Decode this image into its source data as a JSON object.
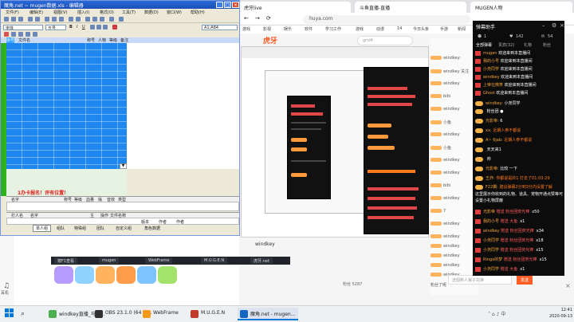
{
  "browser": {
    "tabs": [
      "虎牙live",
      "斗鱼直播-直播",
      "MUGEN人物"
    ],
    "url": "huya.com",
    "bookmarks": [
      "游戏",
      "影视",
      "娱乐",
      "软件",
      "学习工作",
      "游戏",
      "动漫",
      "14",
      "今日头条",
      "手游",
      "新闻"
    ]
  },
  "site": {
    "logo": "虎牙",
    "search_placeholder": "grid4",
    "host_name": "windkey",
    "fans_label": "粉丝 5287",
    "input_placeholder": "送個新人電子兑换",
    "send_label": "发送",
    "mini_taskbar": [
      "按F1查看",
      "mugen",
      "WebFrame",
      "M.U.G.E.N",
      "虎牙.net"
    ],
    "chat_lines": [
      "windkey:",
      "windkey 关注",
      "windkey",
      "bibi",
      "windkey",
      "小鱼",
      "windkey",
      "小鱼",
      "windkey",
      "windkey",
      "bibi",
      "windkey",
      "7",
      "windkey",
      "windkey",
      "windkey",
      "windkey",
      "windkey",
      "windkey",
      "粉丝了呢"
    ]
  },
  "danmu": {
    "title": "弹幕助手",
    "stats": {
      "viewers": "1",
      "fans": "142",
      "count": "54"
    },
    "tabs": [
      "全部弹幕",
      "贵宾(32)",
      "礼物",
      "粉丝"
    ],
    "welcome_lines": [
      {
        "user": "mugen",
        "text": "欢迎来到本直播间"
      },
      {
        "user": "我的小号",
        "text": "欢迎来到本直播间"
      },
      {
        "user": "小尧同学",
        "text": "欢迎来到本直播间"
      },
      {
        "user": "windkey",
        "text": "欢迎来到本直播间"
      },
      {
        "user": "上帝在微笑",
        "text": "欢迎来到本直播间"
      },
      {
        "user": "Ghost",
        "text": "欢迎来到本直播间"
      }
    ],
    "chat_lines": [
      {
        "user": "windkey:",
        "text": "小尧同学"
      },
      {
        "user": "",
        "text": "粉丝团 ●"
      },
      {
        "user": "光影帝:",
        "text": "6"
      },
      {
        "user": "xx:",
        "text": "近期人参不都说"
      },
      {
        "user": "A~ 6jab:",
        "text": "近期人参不都说"
      },
      {
        "user": "",
        "text": "天天来1"
      },
      {
        "user": "",
        "text": "帅"
      },
      {
        "user": "光影帝:",
        "text": "比较 一下"
      },
      {
        "user": "王炸:",
        "text": "你都说是的1 打去了01:03:29"
      },
      {
        "user": "F22霸:",
        "text": "建议弹幕2分到3分内设置了解"
      }
    ],
    "notice": "这里展示你收到的礼物、道具、宠物开通点赞等可设置小礼物屏蔽",
    "gift_lines": [
      {
        "user": "光影帝",
        "gift": "赠送 粉丝团荧光棒",
        "count": "x50"
      },
      {
        "user": "我的小号",
        "gift": "赠送 大鱼",
        "count": "x1"
      },
      {
        "user": "windkey",
        "gift": "赠送 粉丝团荧光棒",
        "count": "x34"
      },
      {
        "user": "小尧同学",
        "gift": "赠送 粉丝团荧光棒",
        "count": "x18"
      },
      {
        "user": "小尧同学",
        "gift": "赠送 粉丝团荧光棒",
        "count": "x15"
      },
      {
        "user": "Ringo的梦",
        "gift": "赠送 粉丝团荧光棒",
        "count": "x15"
      },
      {
        "user": "小尧同学",
        "gift": "赠送 大鱼",
        "count": "x1"
      }
    ]
  },
  "editor": {
    "title": "魔角.net ~ mugen数据.xls - 编辑器",
    "menu": [
      "文件(F)",
      "编辑(E)",
      "视图(V)",
      "插入(I)",
      "格式(O)",
      "工具(T)",
      "数据(D)",
      "窗口(W)",
      "帮助(H)"
    ],
    "font": "宋体",
    "font_size": "五号",
    "cell_ref": "A1:A84",
    "header_cols": [
      "序号",
      "文件名",
      "称号",
      "人物",
      "等级",
      "备注"
    ],
    "warning": "1办卡报名！评有位置！",
    "cols_a": [
      "名字",
      "称号",
      "等级",
      "血量",
      "操",
      "音效",
      "类型"
    ],
    "cols_b": [
      "打人名",
      "名字",
      "主",
      "操作",
      "文件名称"
    ],
    "cols_c": [
      "版本",
      "作者",
      "作者"
    ],
    "tabs": [
      "单人组",
      "组队",
      "特殊组",
      "团队",
      "自定义组",
      "角色数据"
    ]
  },
  "taskbar": {
    "apps": [
      {
        "label": "windkey直播_马里...",
        "color": "#4caf50"
      },
      {
        "label": "OBS 23.1.0 (64 bi...",
        "color": "#303030"
      },
      {
        "label": "WebFrame",
        "color": "#f59b1a"
      },
      {
        "label": "M.U.G.E.N",
        "color": "#c0392b"
      },
      {
        "label": "魔角.net - mugen...",
        "color": "#1565c0"
      }
    ],
    "time": "12:41",
    "date": "2020-09-13"
  },
  "leftbar": {
    "label": "耳机"
  }
}
